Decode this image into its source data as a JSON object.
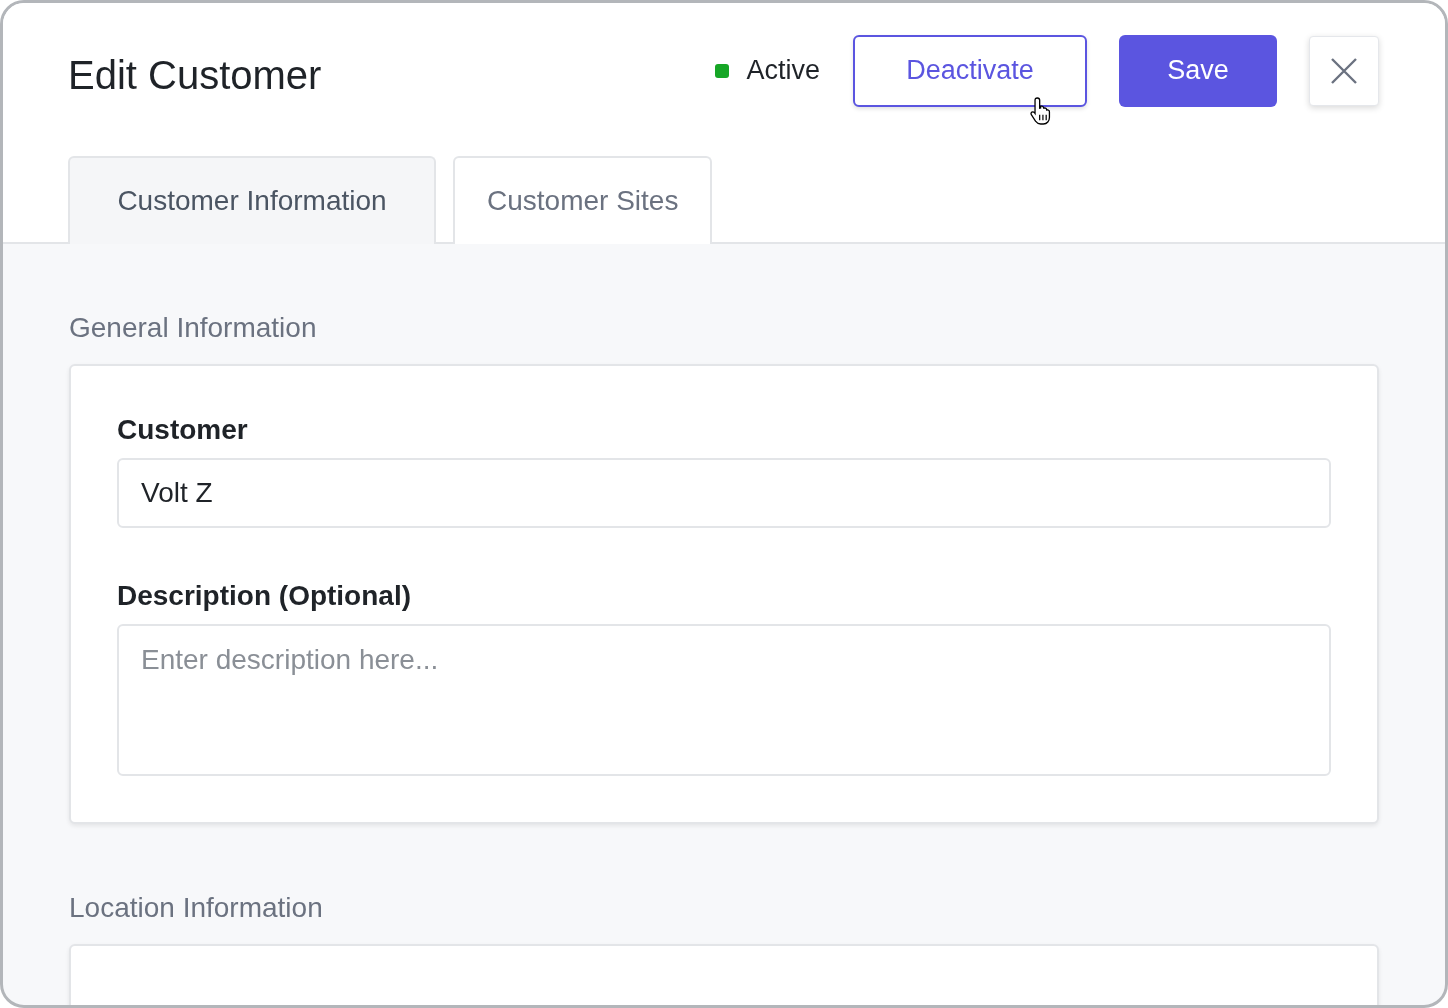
{
  "window": {
    "title": "Edit Customer"
  },
  "status": {
    "label": "Active",
    "active": true
  },
  "actions": [
    {
      "kind": "outline",
      "label": "Deactivate",
      "hovered": true
    },
    {
      "kind": "primary",
      "label": "Save",
      "hovered": false
    }
  ],
  "tabs": [
    {
      "label": "Customer Information",
      "selected": true
    },
    {
      "label": "Customer Sites",
      "selected": false
    }
  ],
  "sections": [
    {
      "title": "General Information",
      "fields": [
        {
          "kind": "input",
          "label": "Customer",
          "value": "Volt Z"
        },
        {
          "kind": "textarea",
          "label": "Description (Optional)",
          "placeholder": "Enter description here..."
        }
      ]
    },
    {
      "title": "Location Information"
    }
  ]
}
